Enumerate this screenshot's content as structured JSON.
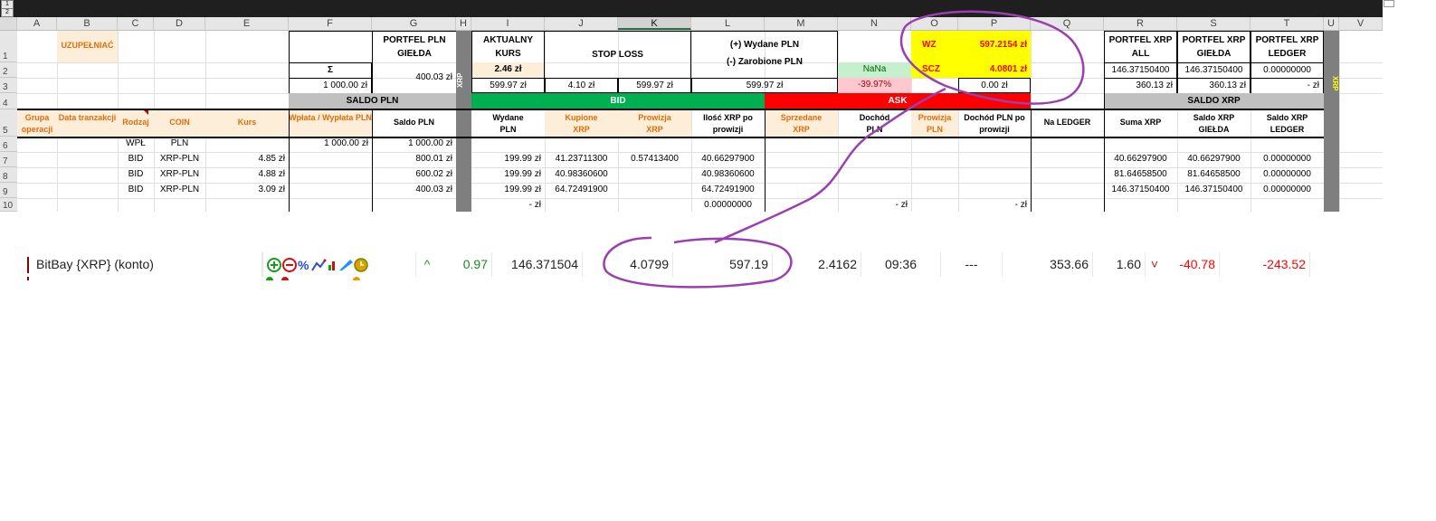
{
  "outline_buttons": [
    "1",
    "2"
  ],
  "columns": [
    "A",
    "B",
    "C",
    "D",
    "E",
    "F",
    "G",
    "H",
    "I",
    "J",
    "K",
    "L",
    "M",
    "N",
    "O",
    "P",
    "Q",
    "R",
    "S",
    "T",
    "U",
    "V"
  ],
  "rows": [
    "1",
    "2",
    "3",
    "4",
    "5",
    "6",
    "7",
    "8",
    "9",
    "10"
  ],
  "sheet": {
    "uzupelniac": "UZUPEŁNIAĆ",
    "portfel_pln": "PORTFEL PLN GIEŁDA",
    "portfel_pln_value": "400.03 zł",
    "sigma": "Σ",
    "f3": "1 000.00 zł",
    "saldo_pln": "SALDO PLN",
    "xrp_vertical": "XRP",
    "aktualny_kurs": "AKTUALNY KURS",
    "i2": "2.46 zł",
    "i3": "599.97 zł",
    "stop_loss": "STOP LOSS",
    "j3": "4.10 zł",
    "k3": "599.97 zł",
    "wydane_label_1": "(+) Wydane PLN",
    "wydane_label_2": "(-) Zarobione PLN",
    "l3": "599.97 zł",
    "n2": "NaNa",
    "n3": "-39.97%",
    "wz_label": "WZ",
    "wz_value": "597.2154 zł",
    "scz_label": "ŚCZ",
    "scz_value": "4.0801 zł",
    "p3": "0.00 zł",
    "bid": "BID",
    "ask": "ASK",
    "portfel_xrp_all": "PORTFEL XRP ALL",
    "portfel_xrp_gielda": "PORTFEL XRP GIEŁDA",
    "portfel_xrp_ledger": "PORTFEL XRP LEDGER",
    "r2": "146.37150400",
    "s2": "146.37150400",
    "t2": "0.00000000",
    "r3": "360.13 zł",
    "s3": "360.13 zł",
    "t3": "-    zł",
    "saldo_xrp": "SALDO XRP",
    "u_vertical": "XRP"
  },
  "headers_row5": {
    "A": "Grupa operacji",
    "B": "Data tranzakcji",
    "C": "Rodzaj",
    "D": "COIN",
    "E": "Kurs",
    "F": "Wpłata / Wypłata PLN",
    "G": "Saldo PLN",
    "I": "Wydane PLN",
    "J": "Kupione XRP",
    "K": "Prowizja XRP",
    "L": "Ilość XRP po prowizji",
    "M": "Sprzedane XRP",
    "N": "Dochód PLN",
    "O": "Prowizja PLN",
    "P": "Dochód PLN po prowizji",
    "Q": "Na LEDGER",
    "R": "Suma XRP",
    "S": "Saldo XRP GIEŁDA",
    "T": "Saldo XRP LEDGER"
  },
  "data_rows": [
    {
      "C": "WPŁ",
      "D": "PLN",
      "E": "",
      "F": "1 000.00 zł",
      "G": "1 000.00 zł",
      "I": "",
      "J": "",
      "K": "",
      "L": "",
      "N": "",
      "P": "",
      "R": "",
      "S": "",
      "T": ""
    },
    {
      "C": "BID",
      "D": "XRP-PLN",
      "E": "4.85 zł",
      "F": "",
      "G": "800.01 zł",
      "I": "199.99 zł",
      "J": "41.23711300",
      "K": "0.57413400",
      "L": "40.66297900",
      "N": "",
      "P": "",
      "R": "40.66297900",
      "S": "40.66297900",
      "T": "0.00000000"
    },
    {
      "C": "BID",
      "D": "XRP-PLN",
      "E": "4.88 zł",
      "F": "",
      "G": "600.02 zł",
      "I": "199.99 zł",
      "J": "40.98360600",
      "K": "",
      "L": "40.98360600",
      "N": "",
      "P": "",
      "R": "81.64658500",
      "S": "81.64658500",
      "T": "0.00000000"
    },
    {
      "C": "BID",
      "D": "XRP-PLN",
      "E": "3.09 zł",
      "F": "",
      "G": "400.03 zł",
      "I": "199.99 zł",
      "J": "64.72491900",
      "K": "",
      "L": "64.72491900",
      "N": "",
      "P": "",
      "R": "146.37150400",
      "S": "146.37150400",
      "T": "0.00000000"
    },
    {
      "C": "",
      "D": "",
      "E": "",
      "F": "",
      "G": "",
      "I": "-    zł",
      "J": "",
      "K": "",
      "L": "0.00000000",
      "N": "-    zł",
      "P": "-    zł",
      "R": "",
      "S": "",
      "T": ""
    }
  ],
  "ticker": {
    "name": "BitBay {XRP} (konto)",
    "icons": [
      "plus-circle",
      "minus-circle",
      "percent",
      "chart",
      "pencil",
      "clock"
    ],
    "change_arrow": "^",
    "c1": "0.97",
    "c2": "146.371504",
    "c3": "4.0799",
    "c4": "597.19",
    "c5": "2.4162",
    "c6": "09:36",
    "c7": "---",
    "c8": "353.66",
    "c9": "1.60",
    "down_arrow": "˅",
    "c10": "-40.78",
    "c11": "-243.52"
  },
  "colors": {
    "bid_green": "#00b050",
    "ask_red": "#ff0000",
    "wz_yellow": "#ffff00",
    "annotation_purple": "#9b3fb0",
    "orange_header": "#e36c09"
  }
}
